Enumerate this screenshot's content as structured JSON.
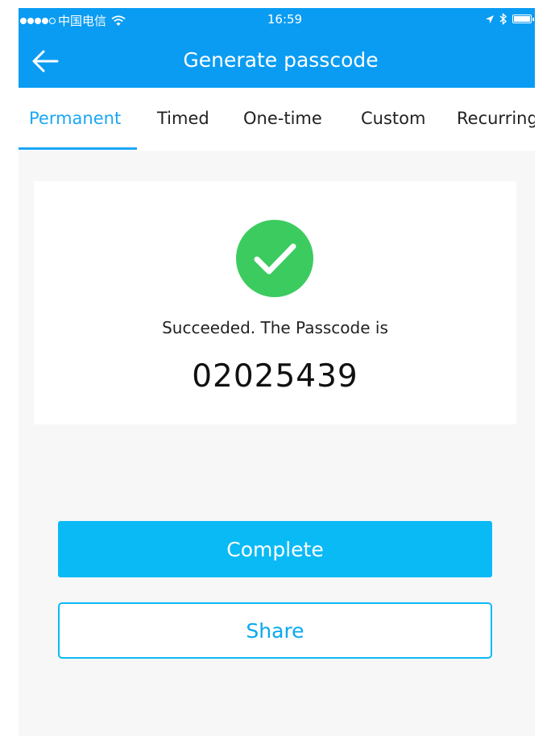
{
  "status_bar": {
    "carrier": "中国电信",
    "time": "16:59"
  },
  "nav": {
    "title": "Generate passcode"
  },
  "tabs": [
    {
      "label": "Permanent",
      "active": true
    },
    {
      "label": "Timed",
      "active": false
    },
    {
      "label": "One-time",
      "active": false
    },
    {
      "label": "Custom",
      "active": false
    },
    {
      "label": "Recurring",
      "active": false
    }
  ],
  "result": {
    "message": "Succeeded. The Passcode is",
    "passcode": "02025439"
  },
  "buttons": {
    "complete": "Complete",
    "share": "Share"
  },
  "colors": {
    "header_blue": "#0a9cf2",
    "accent": "#1aa7f4",
    "button_blue": "#0abaf5",
    "success_green": "#3ccb5f"
  }
}
